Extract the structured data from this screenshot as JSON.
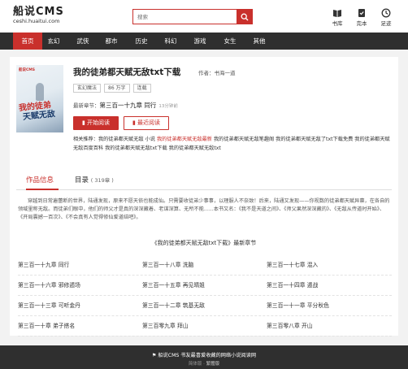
{
  "header": {
    "logo_title": "船说CMS",
    "logo_sub": "ceshi.huaitui.com",
    "search_placeholder": "搜索",
    "icons": [
      {
        "label": "书库",
        "icon": "book-icon"
      },
      {
        "label": "完本",
        "icon": "finished-icon"
      },
      {
        "label": "足迹",
        "icon": "history-icon"
      }
    ]
  },
  "nav": {
    "items": [
      "首页",
      "玄幻",
      "武侠",
      "都市",
      "历史",
      "科幻",
      "游戏",
      "女生",
      "其他"
    ],
    "active_index": 0
  },
  "book": {
    "cover_brand": "船说CMS",
    "cover_line1": "我的徒弟",
    "cover_line2": "天赋无敌",
    "title": "我的徒弟都天赋无敌txt下载",
    "author_label": "作者：",
    "author": "书海一道",
    "tags": [
      "玄幻魔法",
      "86 万字",
      "连载"
    ],
    "latest_label": "最新章节：",
    "latest_chapter": "第三百一十九章 同行",
    "latest_time": "13分钟前",
    "read_button": "开始阅读",
    "recent_button": "最近阅读",
    "related_label": "相关推荐：",
    "related_text_1": "我的徒弟都天赋无敌 小说 ",
    "related_highlight": "我的徒弟都天赋无敌最新",
    "related_text_2": " 我的徒弟都天赋无敌笔趣阁 我的徒弟都天赋无敌了txt下载免费 我的徒弟都天赋无敌百度百科 我的徒弟都天赋无敌txt下载 我的徒弟都天赋无敌txt"
  },
  "tabs": {
    "info": "作品信息",
    "catalog": "目录",
    "catalog_count": "( 319章 )"
  },
  "intro": "穿越到日常遍蕾断的世界，陆通发现，原来不愿天依也能成仙。只需要收徒弟少事事，以理服人不奈致！后来，陆通又发现——你视数的徒弟都天赋异禀，在各自的领域里称无敌。而徒弟们眼中，他们的师父才是真的深深藏着、老谋深算、无所不能......本书又名：《我不是天道之间》、《师父果然深深藏的》、《无敌从传道时开始》、《开局震撼一百次》、《不会真有人觉得修仙爱道结吧》。",
  "latest_section_title": "《我的徒弟都天赋无敌txt下载》最新章节",
  "chapters": [
    "第三百一十九章 同行",
    "第三百一十八章 洗脑",
    "第三百一十七章 混入",
    "第三百一十六章 邪修遁场",
    "第三百一十五章 再见晴姐",
    "第三百一十四章 遁战",
    "第三百一十三章 可听金丹",
    "第三百一十二章 筑基无敌",
    "第三百一十一章 平分秋色",
    "第三百一十章 弟子搭名",
    "第三百零九章 拜山",
    "第三百零八章 开山"
  ],
  "footer": {
    "main": "船说CMS 书友最喜爱收藏的网络小说阅读网",
    "sub_label": "简体版 · ",
    "sub_link": "繁體版"
  }
}
